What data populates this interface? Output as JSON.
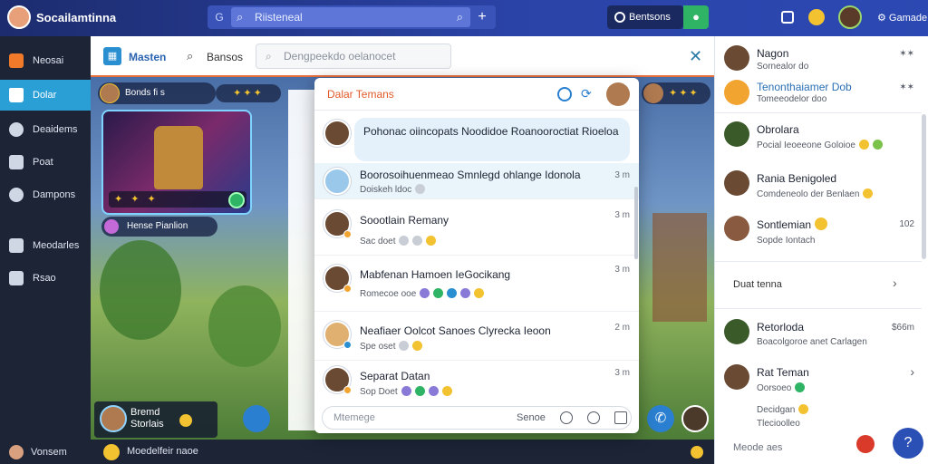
{
  "topbar": {
    "app_name": "Socailamtinna",
    "search_prefix": "G",
    "search_placeholder": "Riisteneal",
    "plus": "+",
    "mode_label": "Bentsons",
    "user_name": "Gamade"
  },
  "sidebar": {
    "items": [
      {
        "label": "Neosai",
        "color": "#f07a2a"
      },
      {
        "label": "Dolar",
        "color": "#ffffff"
      },
      {
        "label": "Deaidems",
        "color": "#cfd6e4"
      },
      {
        "label": "Poat",
        "color": "#cfd6e4"
      },
      {
        "label": "Dampons",
        "color": "#cfd6e4"
      },
      {
        "label": "Meodarles",
        "color": "#cfd6e4"
      },
      {
        "label": "Rsao",
        "color": "#cfd6e4"
      }
    ],
    "footer_label": "Vonsem"
  },
  "main_header": {
    "tab_active": "Masten",
    "tab_search": "Bansos",
    "search_placeholder": "Dengpeekdo oelanocet",
    "close": "✕"
  },
  "scene": {
    "player_tag": "Bonds fi s",
    "rewards": "✦✦✦",
    "card_bar": "✦ ✦ ✦",
    "pill_label": "Hense Pianlion",
    "leftbox_line1": "Bremd",
    "leftbox_line2": "Storlais",
    "right_player": "✦✦✦",
    "fab_call": "✆"
  },
  "status_bar": {
    "text": "Moedelfeir naoe"
  },
  "popup": {
    "title": "Dalar Temans",
    "bubble": "Pohonac oiincopats Noodidoe Roanooroctiat Rioeloa",
    "rows": [
      {
        "name": "Boorosoihuenmeao Smnlegd ohlange Idonola",
        "sub": "Doiskeh ldoc",
        "time": "3 m"
      },
      {
        "name": "Soootlain Remany",
        "sub": "Sac doet",
        "time": "3 m"
      },
      {
        "name": "Mabfenan Hamoen IeGocikang",
        "sub": "Romecoe ooe",
        "time": "3 m"
      },
      {
        "name": "Neafiaer Oolcot Sanoes Clyrecka Ieoon",
        "sub": "Spe oset",
        "time": "2 m"
      },
      {
        "name": "Separat Datan",
        "sub": "Sop Doet",
        "time": "3 m"
      }
    ],
    "compose_placeholder": "Mtemege",
    "compose_send": "Senoe"
  },
  "right_panel": {
    "rows": [
      {
        "name": "Nagon",
        "sub": "Sornealor do",
        "meta": "✶✶"
      },
      {
        "name": "Tenonthaiamer Dob",
        "sub": "Tomeeodelor doo",
        "meta": "✶✶"
      },
      {
        "name": "Obrolara",
        "sub": "Pocial Ieoeeone Goloioe",
        "meta": ""
      },
      {
        "name": "Rania Benigoled",
        "sub": "Comdeneolo der Benlaen",
        "meta": ""
      },
      {
        "name": "Sontlemian",
        "sub": "Sopde Iontach",
        "meta": "102"
      }
    ],
    "section_label": "Duat tenna",
    "section_chevron": "›",
    "rows2": [
      {
        "name": "Retorloda",
        "sub": "Boacolgoroe anet Carlagen",
        "meta": "$66m"
      },
      {
        "name": "Rat Teman",
        "sub": "Oorsoeo",
        "meta": "›"
      },
      {
        "name": "Decidgan",
        "sub": "Tlecioolleo",
        "meta": ""
      }
    ],
    "footer": "Meode aes",
    "fab": "?"
  }
}
